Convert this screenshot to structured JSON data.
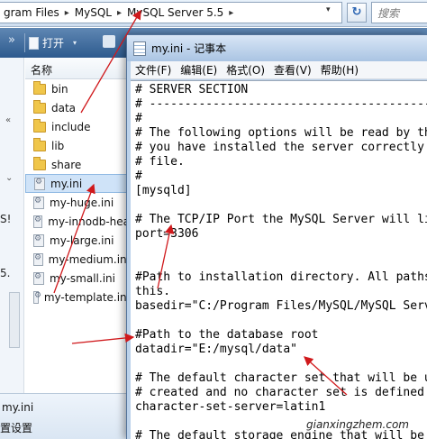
{
  "explorer": {
    "breadcrumb": [
      "gram Files",
      "MySQL",
      "MySQL Server 5.5"
    ],
    "breadcrumb_sep": "▸",
    "dropdown_glyph": "▾",
    "refresh_glyph": "↻",
    "search_placeholder": "搜索",
    "toolbar": {
      "chevron": "»",
      "open_label": "打开",
      "open_arrow": "▾"
    },
    "left_pane": {
      "chevron_top": "«",
      "chevron_mid": "⌄",
      "text_a": "S!",
      "text_b": "5."
    },
    "column_header": "名称",
    "files": [
      {
        "name": "bin",
        "icon": "folder-icon"
      },
      {
        "name": "data",
        "icon": "folder-icon"
      },
      {
        "name": "include",
        "icon": "folder-icon"
      },
      {
        "name": "lib",
        "icon": "folder-icon"
      },
      {
        "name": "share",
        "icon": "folder-icon"
      },
      {
        "name": "my.ini",
        "icon": "ini-icon",
        "selected": true
      },
      {
        "name": "my-huge.ini",
        "icon": "ini-icon"
      },
      {
        "name": "my-innodb-hea",
        "icon": "ini-icon"
      },
      {
        "name": "my-large.ini",
        "icon": "ini-icon"
      },
      {
        "name": "my-medium.ini",
        "icon": "ini-icon"
      },
      {
        "name": "my-small.ini",
        "icon": "ini-icon"
      },
      {
        "name": "my-template.ini",
        "icon": "ini-icon"
      }
    ],
    "status": {
      "name": "my.ini",
      "detail": "置设置"
    }
  },
  "notepad": {
    "title": "my.ini - 记事本",
    "menu": [
      "文件(F)",
      "编辑(E)",
      "格式(O)",
      "查看(V)",
      "帮助(H)"
    ],
    "lines": [
      "# SERVER SECTION",
      "# ----------------------------------------------------",
      "#",
      "# The following options will be read by the",
      "# you have installed the server correctly (se",
      "# file.",
      "#",
      "[mysqld]",
      "",
      "# The TCP/IP Port the MySQL Server will liste",
      "port=3306",
      "",
      "",
      "#Path to installation directory. All paths a",
      "this.",
      "basedir=\"C:/Program Files/MySQL/MySQL Server",
      "",
      "#Path to the database root",
      "datadir=\"E:/mysql/data\"",
      "",
      "# The default character set that will be use",
      "# created and no character set is defined",
      "character-set-server=latin1",
      "",
      "# The default storage engine that will be use"
    ]
  },
  "watermark": "gianxingzhem.com",
  "colors": {
    "annotation_arrow": "#d0191c",
    "toolbar": "#2d5a8e",
    "selection": "#cfe3f8"
  }
}
